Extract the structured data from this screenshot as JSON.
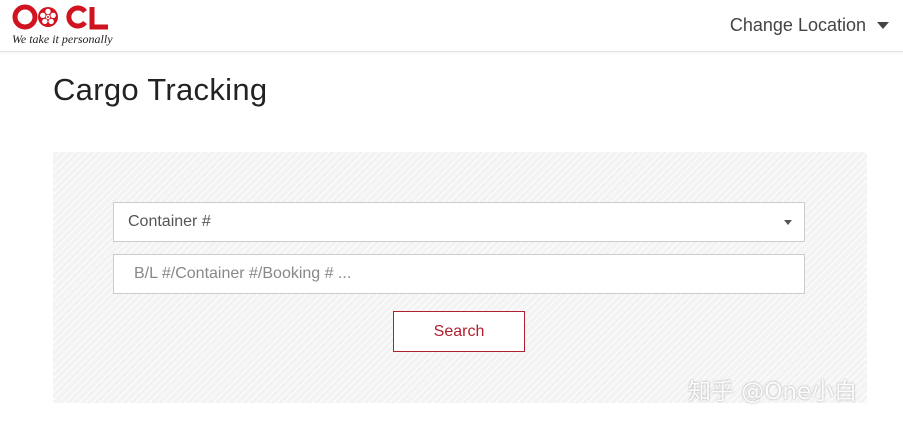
{
  "brand": {
    "logo_text": "OOCL",
    "tagline": "We take it personally",
    "color": "#d1121f"
  },
  "header": {
    "change_location_label": "Change Location"
  },
  "page": {
    "title": "Cargo Tracking"
  },
  "search_form": {
    "type_select_value": "Container #",
    "input_value": "",
    "input_placeholder": "B/L #/Container #/Booking # ...",
    "search_button_label": "Search"
  },
  "watermark": {
    "text": "知乎 @One小白"
  },
  "colors": {
    "accent": "#b0202e",
    "panel_bg": "#f3f3f3"
  },
  "icons": {
    "change_location_caret": "caret-down-icon",
    "select_arrow": "dropdown-arrow-icon"
  }
}
